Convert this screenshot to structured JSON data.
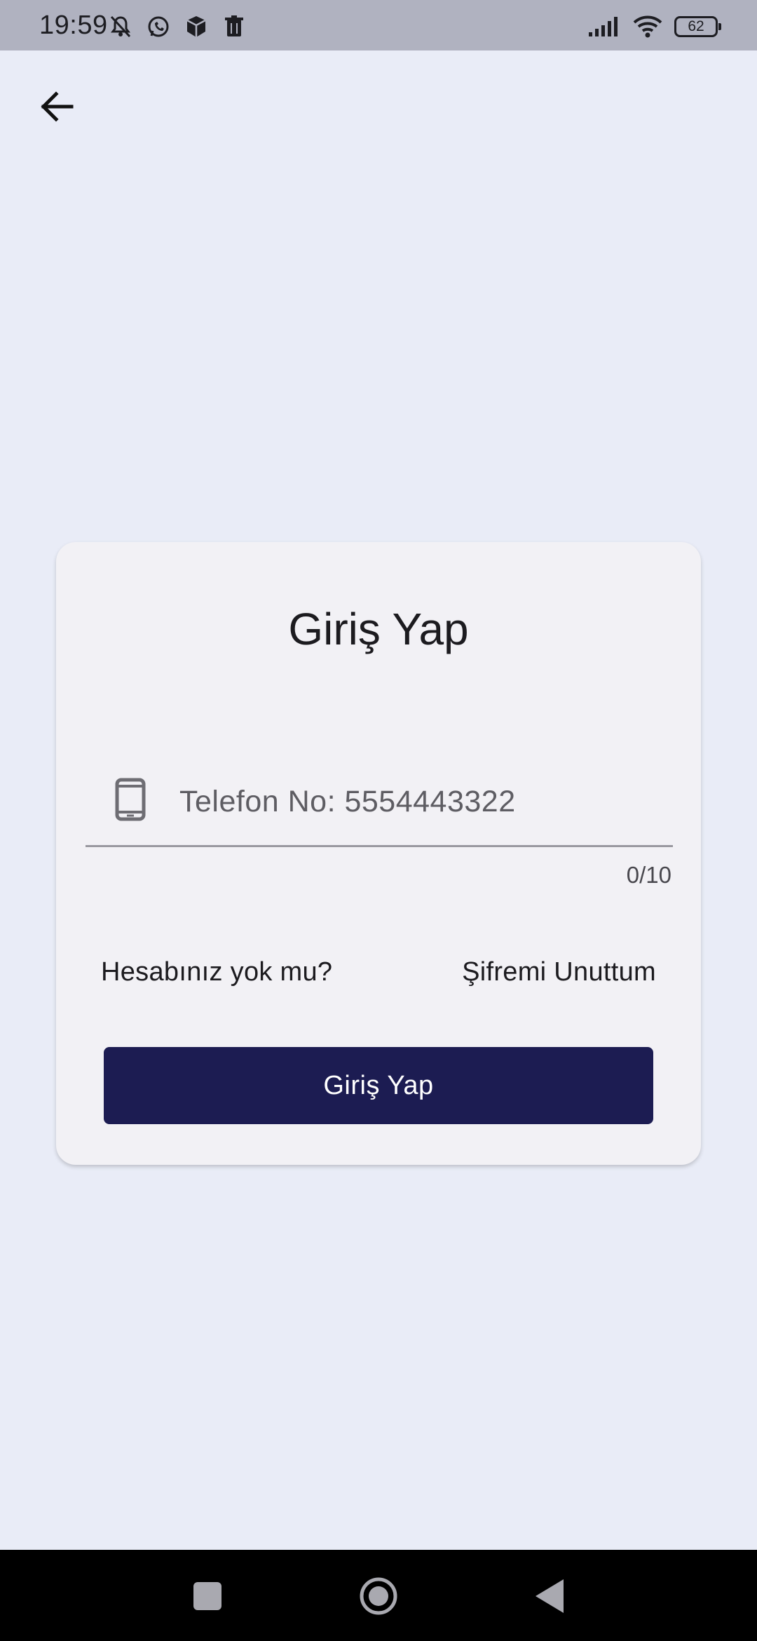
{
  "status_bar": {
    "time": "19:59",
    "battery": "62",
    "left_icons": [
      "mute-icon",
      "whatsapp-icon",
      "package-icon",
      "trash-icon"
    ],
    "right_icons": [
      "signal-icon",
      "wifi-icon",
      "battery-icon"
    ]
  },
  "header": {
    "back_icon": "arrow-left-icon"
  },
  "login_card": {
    "title": "Giriş Yap",
    "phone_field": {
      "icon": "smartphone-icon",
      "placeholder": "Telefon No: 5554443322",
      "value": "",
      "counter": "0/10"
    },
    "register_link": "Hesabınız yok mu?",
    "forgot_link": "Şifremi Unuttum",
    "submit_label": "Giriş Yap"
  },
  "colors": {
    "background": "#e9ecf7",
    "card": "#f2f1f5",
    "primary_button": "#1c1c52",
    "status_bar": "#b0b2c0"
  },
  "navigation_bar": {
    "buttons": [
      "recents-button",
      "home-button",
      "back-button"
    ]
  }
}
